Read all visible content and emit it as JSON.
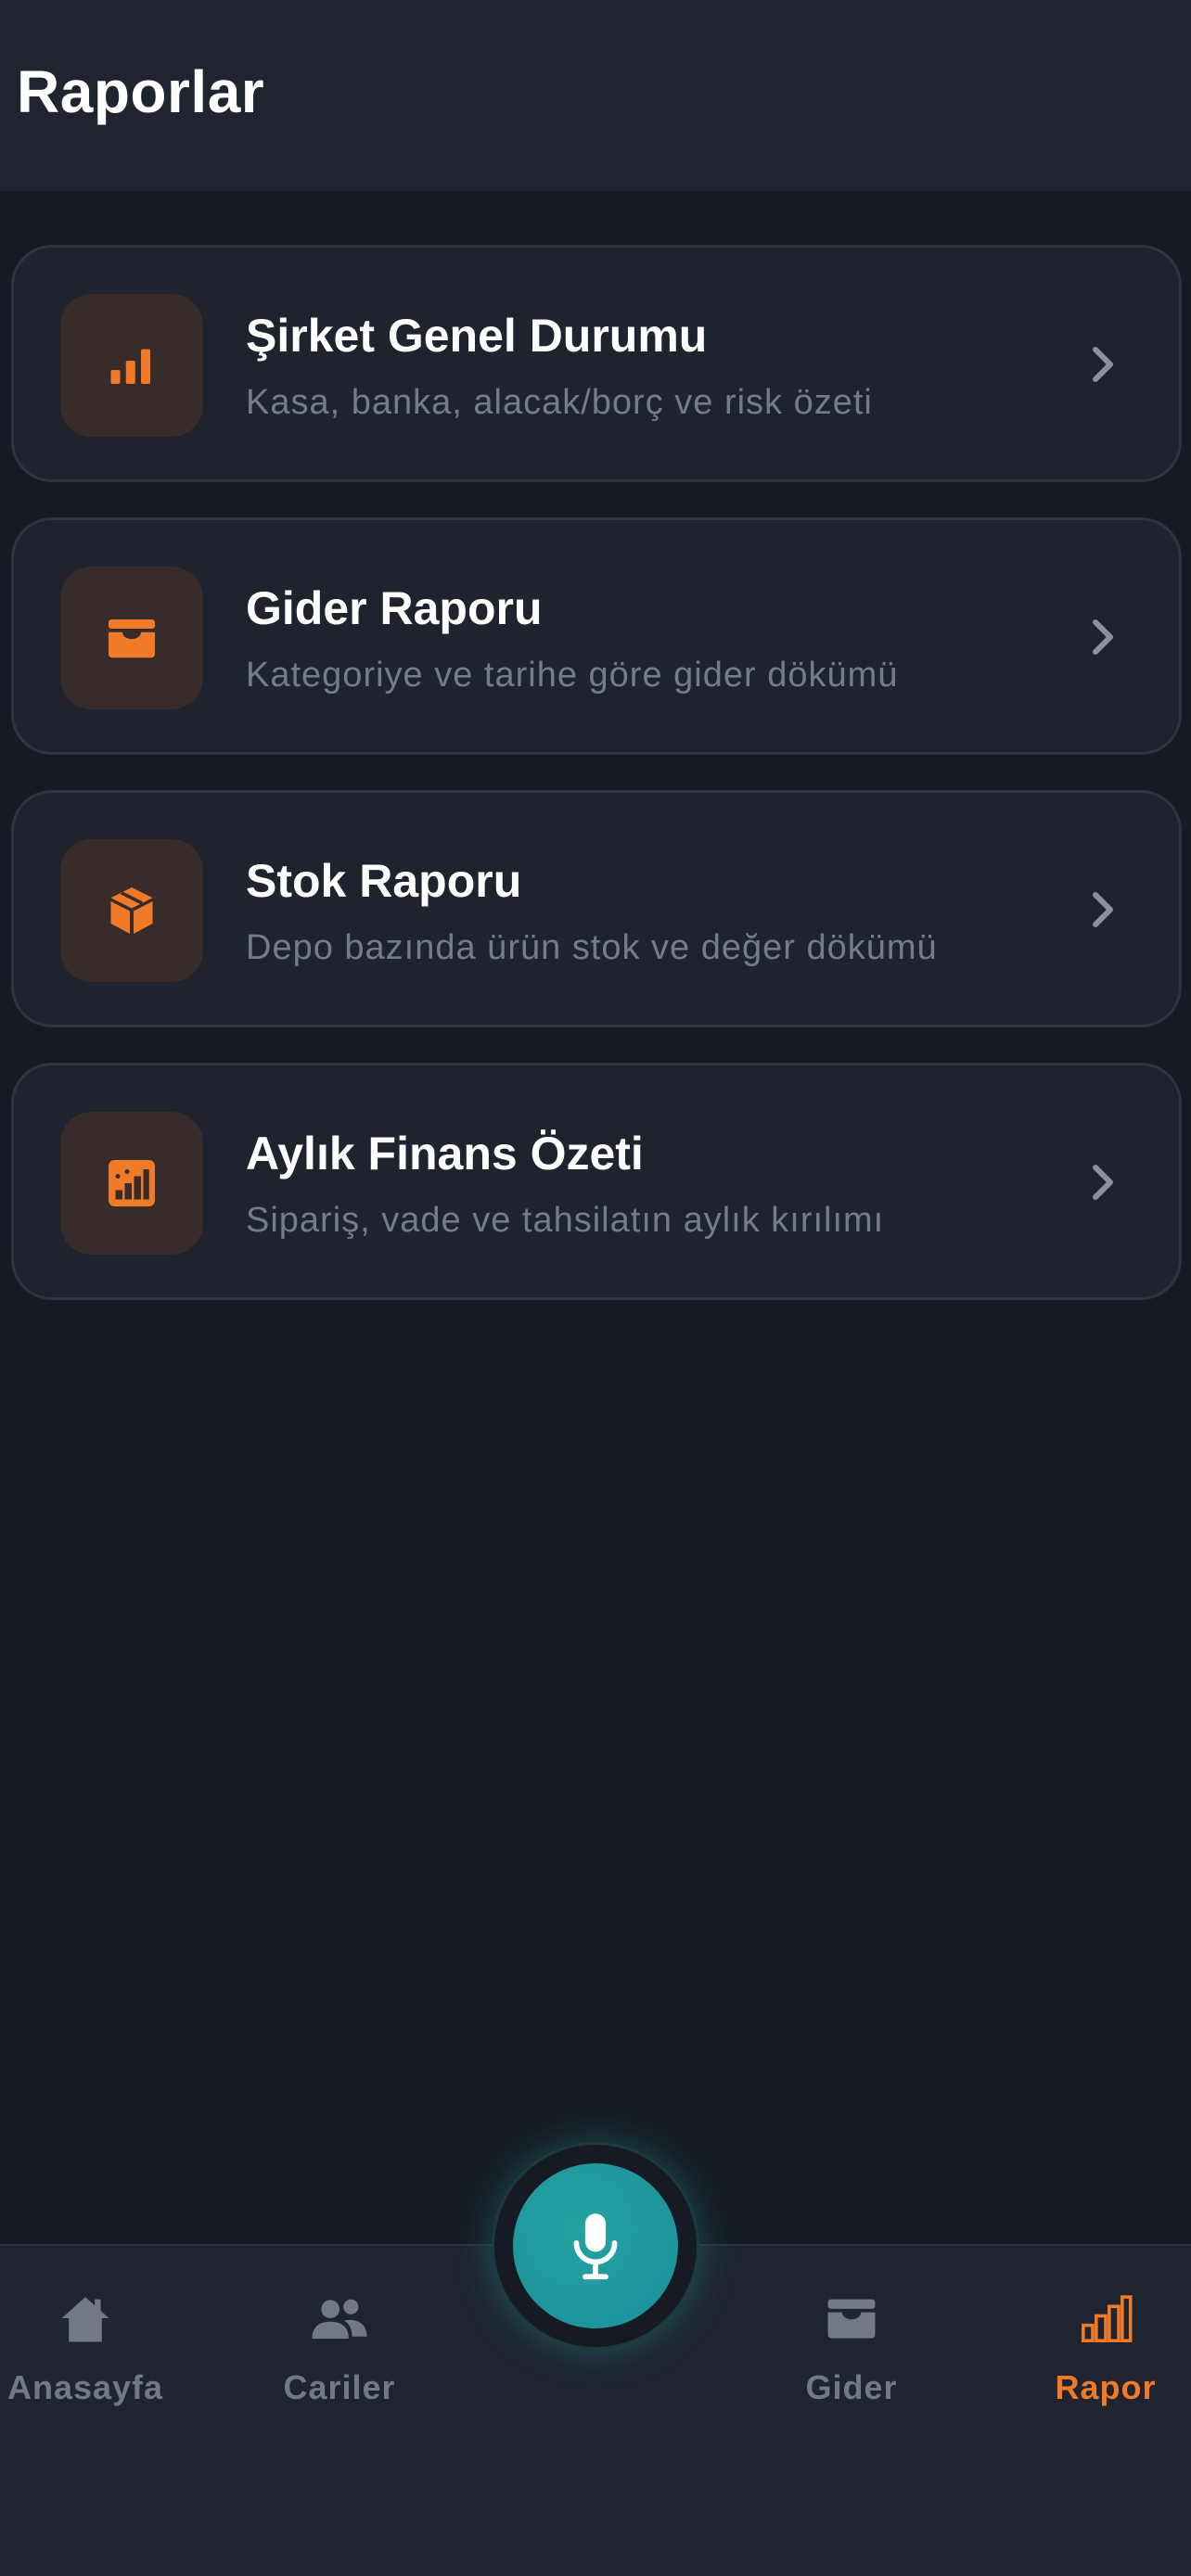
{
  "header": {
    "title": "Raporlar"
  },
  "reports": [
    {
      "title": "Şirket Genel Durumu",
      "subtitle": "Kasa, banka, alacak/borç ve risk özeti",
      "icon": "bar-chart-icon"
    },
    {
      "title": "Gider Raporu",
      "subtitle": "Kategoriye ve tarihe göre gider dökümü",
      "icon": "wallet-icon"
    },
    {
      "title": "Stok Raporu",
      "subtitle": "Depo bazında ürün stok ve değer dökümü",
      "icon": "box-icon"
    },
    {
      "title": "Aylık Finans Özeti",
      "subtitle": "Sipariş, vade ve tahsilatın aylık kırılımı",
      "icon": "finance-chart-icon"
    }
  ],
  "nav": {
    "home": "Anasayfa",
    "accounts": "Cariler",
    "expense": "Gider",
    "report": "Rapor"
  },
  "colors": {
    "accent": "#f07a27",
    "mic": "#23a3a1",
    "background": "#161b23",
    "card": "#1f232e"
  }
}
